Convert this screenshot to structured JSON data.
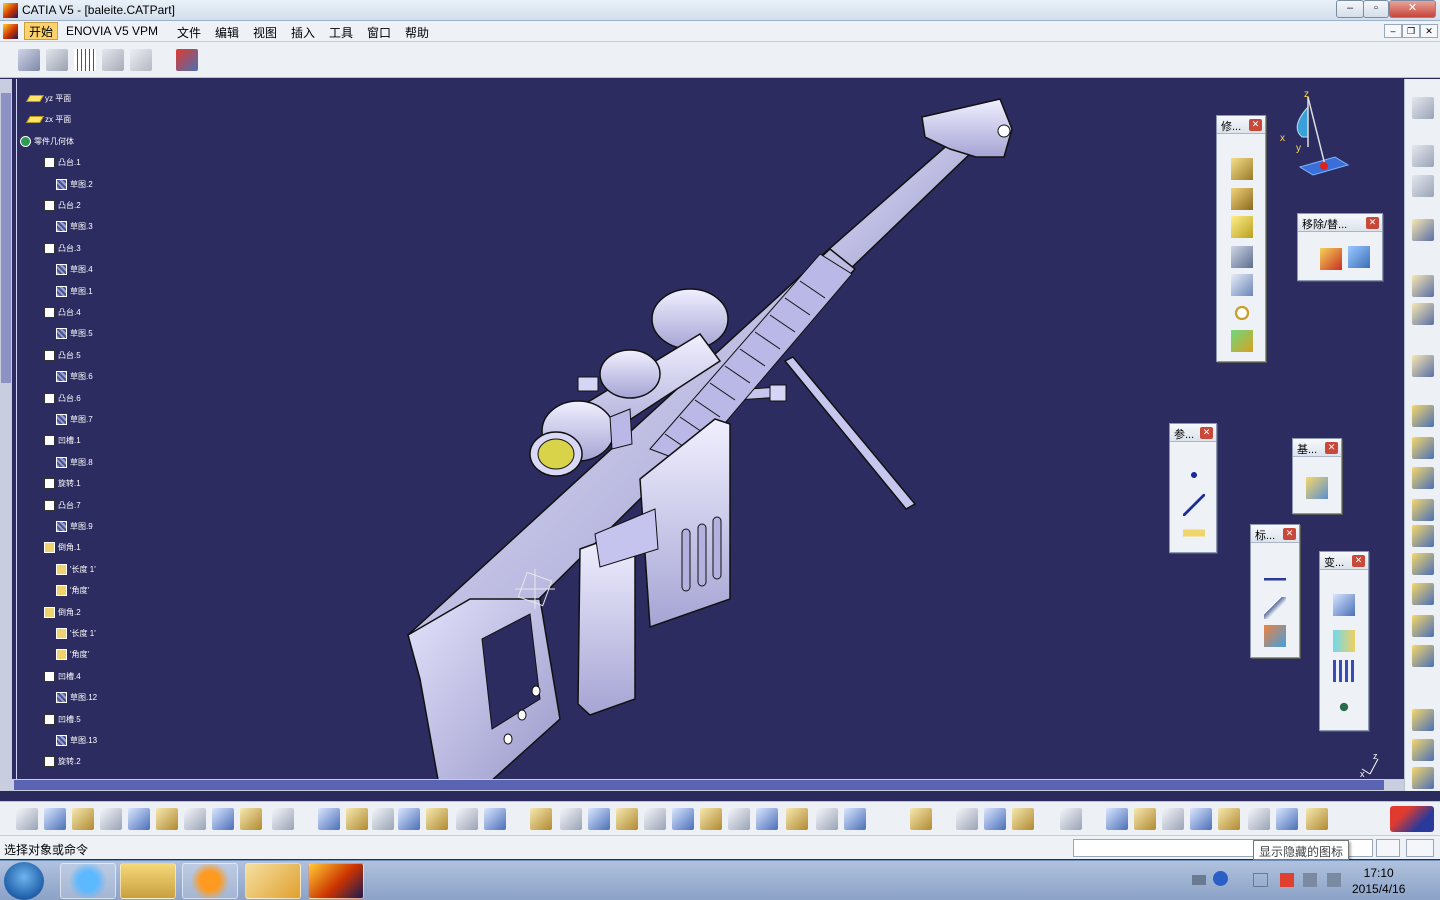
{
  "window": {
    "title": "CATIA V5 - [baleite.CATPart]"
  },
  "menu": {
    "items": [
      "开始",
      "ENOVIA V5 VPM",
      "文件",
      "编辑",
      "视图",
      "插入",
      "工具",
      "窗口",
      "帮助"
    ]
  },
  "tree": {
    "items": [
      {
        "label": "yz 平面",
        "icon": "plane"
      },
      {
        "label": "zx 平面",
        "icon": "plane"
      },
      {
        "label": "零件几何体",
        "icon": "body"
      },
      {
        "label": "凸台.1",
        "icon": "pad"
      },
      {
        "label": "草图.2",
        "icon": "sketch"
      },
      {
        "label": "凸台.2",
        "icon": "pad"
      },
      {
        "label": "草图.3",
        "icon": "sketch"
      },
      {
        "label": "凸台.3",
        "icon": "pad"
      },
      {
        "label": "草图.4",
        "icon": "sketch"
      },
      {
        "label": "草图.1",
        "icon": "sketch"
      },
      {
        "label": "凸台.4",
        "icon": "pad"
      },
      {
        "label": "草图.5",
        "icon": "sketch"
      },
      {
        "label": "凸台.5",
        "icon": "pad"
      },
      {
        "label": "草图.6",
        "icon": "sketch"
      },
      {
        "label": "凸台.6",
        "icon": "pad"
      },
      {
        "label": "草图.7",
        "icon": "sketch"
      },
      {
        "label": "凹槽.1",
        "icon": "pocket"
      },
      {
        "label": "草图.8",
        "icon": "sketch"
      },
      {
        "label": "旋转.1",
        "icon": "shaft"
      },
      {
        "label": "凸台.7",
        "icon": "pad"
      },
      {
        "label": "草图.9",
        "icon": "sketch"
      },
      {
        "label": "倒角.1",
        "icon": "chamfer"
      },
      {
        "label": "'长度 1'",
        "icon": "param"
      },
      {
        "label": "'角度'",
        "icon": "param"
      },
      {
        "label": "倒角.2",
        "icon": "chamfer"
      },
      {
        "label": "'长度 1'",
        "icon": "param"
      },
      {
        "label": "'角度'",
        "icon": "param"
      },
      {
        "label": "凹槽.4",
        "icon": "pocket"
      },
      {
        "label": "草图.12",
        "icon": "sketch"
      },
      {
        "label": "凹槽.5",
        "icon": "pocket"
      },
      {
        "label": "草图.13",
        "icon": "sketch"
      },
      {
        "label": "旋转.2",
        "icon": "shaft"
      }
    ]
  },
  "palettes": {
    "modify": {
      "title": "修..."
    },
    "remove": {
      "title": "移除/替..."
    },
    "reference": {
      "title": "参..."
    },
    "base": {
      "title": "基..."
    },
    "annotation": {
      "title": "标..."
    },
    "transform": {
      "title": "变..."
    }
  },
  "compass": {
    "x": "x",
    "y": "y",
    "z": "z"
  },
  "status": {
    "prompt": "选择对象或命令"
  },
  "tooltip": {
    "text": "显示隐藏的图标"
  },
  "clock": {
    "time": "17:10",
    "date": "2015/4/16"
  },
  "colors": {
    "background": "#2d2c61",
    "model": "#c9c8f2",
    "accent": "#ffd36b"
  }
}
